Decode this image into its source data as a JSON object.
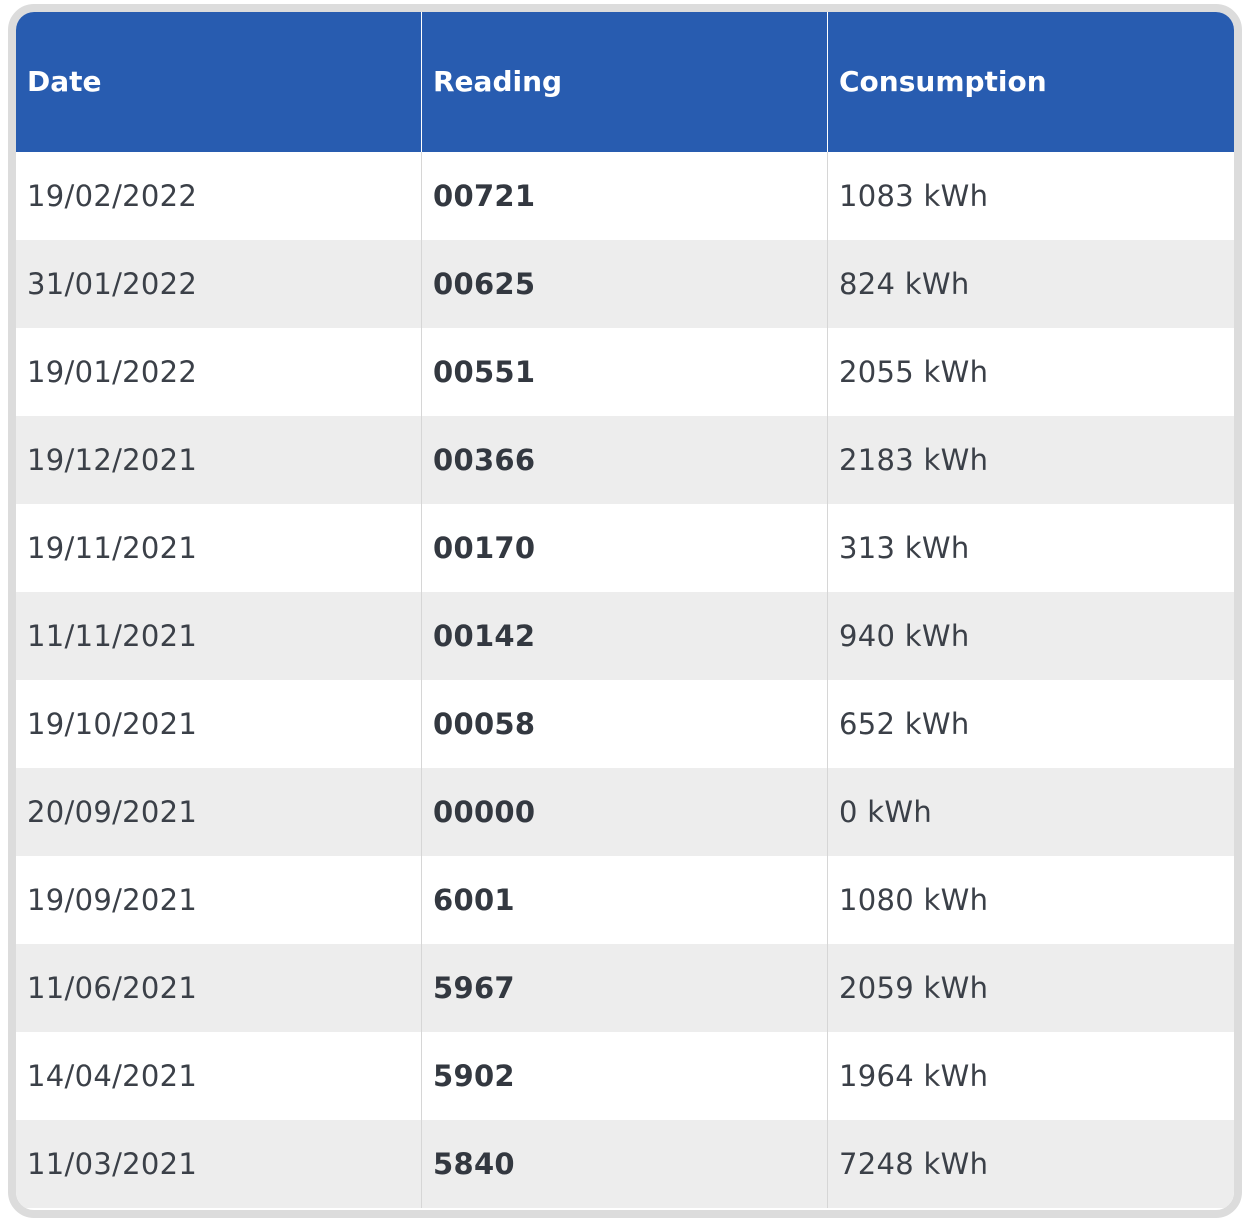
{
  "table": {
    "headers": [
      "Date",
      "Reading",
      "Consumption"
    ],
    "rows": [
      {
        "date": "19/02/2022",
        "reading": "00721",
        "consumption": "1083 kWh"
      },
      {
        "date": "31/01/2022",
        "reading": "00625",
        "consumption": "824 kWh"
      },
      {
        "date": "19/01/2022",
        "reading": "00551",
        "consumption": "2055 kWh"
      },
      {
        "date": "19/12/2021",
        "reading": "00366",
        "consumption": "2183 kWh"
      },
      {
        "date": "19/11/2021",
        "reading": "00170",
        "consumption": "313 kWh"
      },
      {
        "date": "11/11/2021",
        "reading": "00142",
        "consumption": "940 kWh"
      },
      {
        "date": "19/10/2021",
        "reading": "00058",
        "consumption": "652 kWh"
      },
      {
        "date": "20/09/2021",
        "reading": "00000",
        "consumption": "0 kWh"
      },
      {
        "date": "19/09/2021",
        "reading": "6001",
        "consumption": "1080 kWh"
      },
      {
        "date": "11/06/2021",
        "reading": "5967",
        "consumption": "2059 kWh"
      },
      {
        "date": "14/04/2021",
        "reading": "5902",
        "consumption": "1964 kWh"
      },
      {
        "date": "11/03/2021",
        "reading": "5840",
        "consumption": "7248 kWh"
      }
    ]
  },
  "colors": {
    "header_bg": "#285cb0",
    "header_text": "#ffffff",
    "row_alt_bg": "#ededed",
    "frame_border": "#dcdcdc"
  }
}
